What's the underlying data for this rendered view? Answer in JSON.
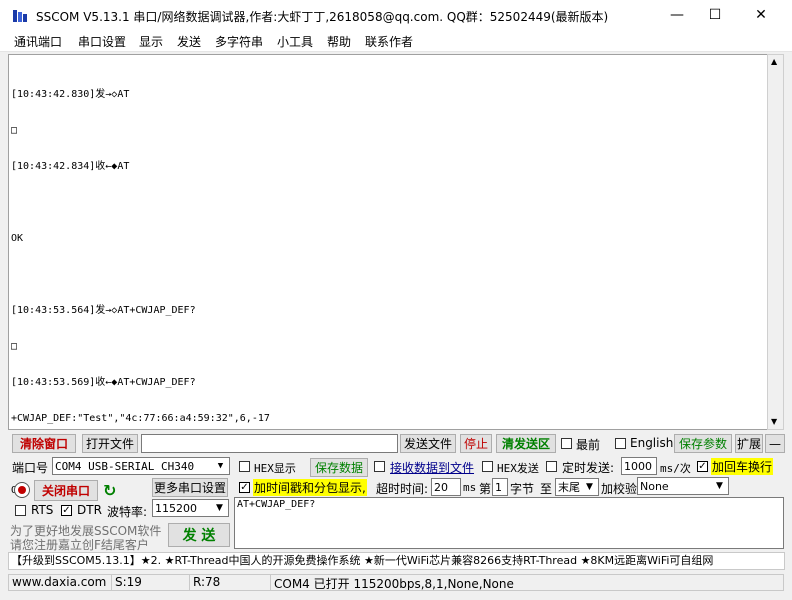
{
  "window": {
    "title": "SSCOM V5.13.1 串口/网络数据调试器,作者:大虾丁丁,2618058@qq.com. QQ群：52502449(最新版本)",
    "minimize": "—",
    "maximize": "☐",
    "close": "✕"
  },
  "menu": [
    "通讯端口",
    "串口设置",
    "显示",
    "发送",
    "多字符串",
    "小工具",
    "帮助",
    "联系作者"
  ],
  "log": [
    "[10:43:42.830]发→◇AT",
    "□",
    "[10:43:42.834]收←◆AT",
    "",
    "OK",
    "",
    "[10:43:53.564]发→◇AT+CWJAP_DEF?",
    "□",
    "[10:43:53.569]收←◆AT+CWJAP_DEF?",
    "+CWJAP_DEF:\"Test\",\"4c:77:66:a4:59:32\",6,-17",
    "",
    "OK"
  ],
  "toolbar": {
    "clear_window": "清除窗口",
    "open_file": "打开文件",
    "file_path": "",
    "send_file": "发送文件",
    "stop": "停止",
    "clear_send": "清发送区",
    "front_most": "最前",
    "english": "English",
    "save_params": "保存参数",
    "expand": "扩展",
    "collapse": "—"
  },
  "port": {
    "label": "端口号",
    "value": "COM4 USB-SERIAL CH340",
    "hex_display": "HEX显示",
    "save_data": "保存数据",
    "recv_to_file": "接收数据到文件",
    "hex_send": "HEX发送",
    "timed_send": "定时发送:",
    "interval": "1000",
    "interval_unit": "ms/次",
    "add_crlf": "加回车换行",
    "close_port": "关闭串口",
    "more_settings": "更多串口设置",
    "add_timestamp": "加时间戳和分包显示,",
    "timeout_label": "超时时间:",
    "timeout_value": "20",
    "timeout_unit": "ms",
    "byte_prefix": "第",
    "byte_index": "1",
    "byte_unit": "字节",
    "to_label": "至",
    "to_value": "末尾",
    "checksum_label": "加校验",
    "checksum_value": "None",
    "rts": "RTS",
    "dtr": "DTR",
    "baud_label": "波特率:",
    "baud_value": "115200",
    "send_text": "AT+CWJAP_DEF?",
    "send_button": "发  送",
    "promo_line1": "为了更好地发展SSCOM软件",
    "promo_line2": "请您注册嘉立创F结尾客户"
  },
  "ticker": "【升级到SSCOM5.13.1】★2. ★RT-Thread中国人的开源免费操作系统 ★新一代WiFi芯片兼容8266支持RT-Thread ★8KM远距离WiFi可自组网",
  "status": {
    "website": "www.daxia.com",
    "sent": "S:19",
    "received": "R:78",
    "port_state": "COM4 已打开  115200bps,8,1,None,None"
  },
  "colors": {
    "highlight_yellow": "#ffff00",
    "accent_red": "#c00000",
    "accent_green": "#008000",
    "ticker_blue": "#0000cc"
  }
}
